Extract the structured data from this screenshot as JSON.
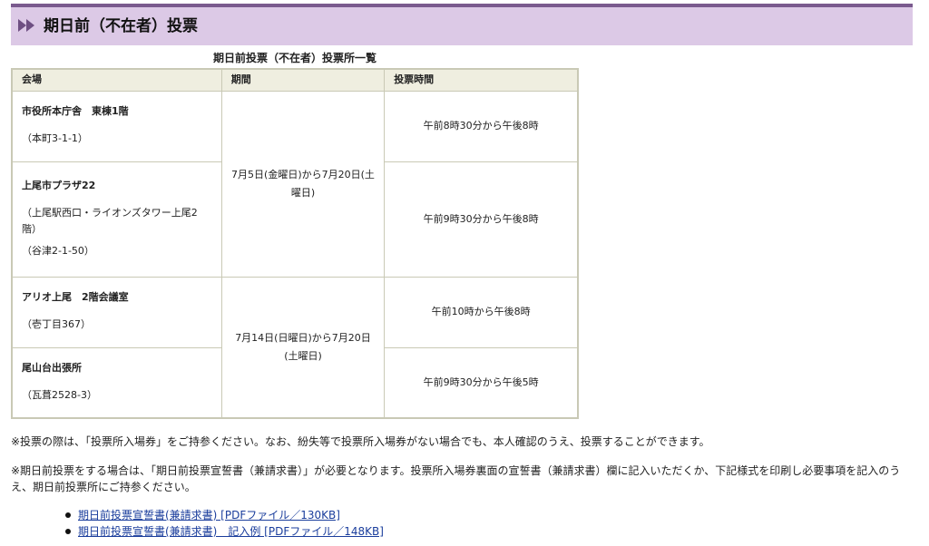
{
  "page": {
    "title": "期日前（不在者）投票"
  },
  "table": {
    "caption": "期日前投票（不在者）投票所一覧",
    "headers": [
      "会場",
      "期間",
      "投票時間"
    ],
    "venues": [
      {
        "name": "市役所本庁舎　東棟1階",
        "lines": [
          "（本町3-1-1）"
        ],
        "hours": "午前8時30分から午後8時"
      },
      {
        "name": "上尾市プラザ22",
        "lines": [
          "（上尾駅西口・ライオンズタワー上尾2階）",
          "（谷津2-1-50）"
        ],
        "hours": "午前9時30分から午後8時"
      },
      {
        "name": "アリオ上尾　2階会議室",
        "lines": [
          "（壱丁目367）"
        ],
        "hours": "午前10時から午後8時"
      },
      {
        "name": "尾山台出張所",
        "lines": [
          "（瓦葺2528-3）"
        ],
        "hours": "午前9時30分から午後5時"
      }
    ],
    "periods": [
      "7月5日(金曜日)から7月20日(土曜日)",
      "7月14日(日曜日)から7月20日(土曜日)"
    ]
  },
  "notes": [
    "※投票の際は、「投票所入場券」をご持参ください。なお、紛失等で投票所入場券がない場合でも、本人確認のうえ、投票することができます。",
    "※期日前投票をする場合は、「期日前投票宣誓書（兼請求書）」が必要となります。投票所入場券裏面の宣誓書（兼請求書）欄に記入いただくか、下記様式を印刷し必要事項を記入のうえ、期日前投票所にご持参ください。"
  ],
  "links": [
    "期日前投票宣誓書(兼請求書) [PDFファイル／130KB]",
    "期日前投票宣誓書(兼請求書)　記入例 [PDFファイル／148KB]"
  ],
  "colors": {
    "heading_bg": "#dcc9e6",
    "heading_border": "#7a5a8e",
    "table_header_bg": "#efeee0",
    "table_border": "#c9c9b5",
    "link": "#1a3d9c"
  }
}
